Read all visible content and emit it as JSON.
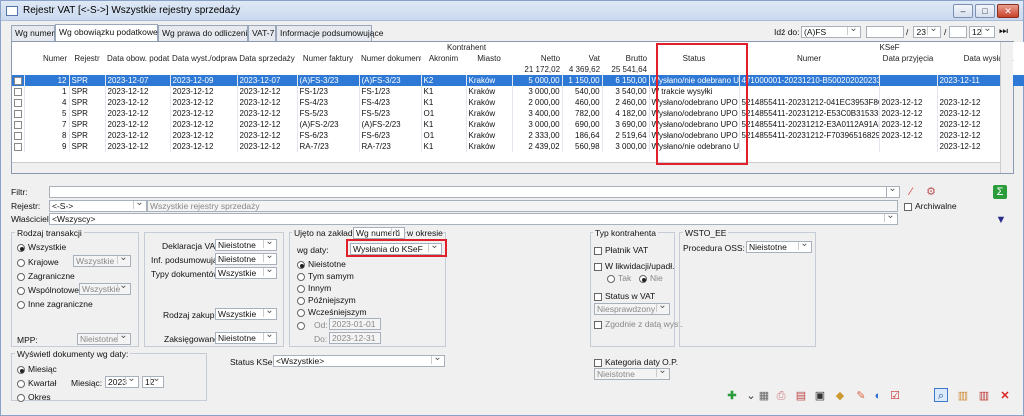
{
  "window": {
    "title": "Rejestr VAT  [<-S->]  Wszystkie rejestry sprzedaży",
    "min": "–",
    "max": "□",
    "close": "✕"
  },
  "tabs": [
    "Wg numeru",
    "Wg obowiązku podatkowego",
    "Wg prawa do odliczenia",
    "VAT-7",
    "Informacje podsumowujące"
  ],
  "nav": {
    "label": "Idź do:",
    "reg": "(A)FS",
    "num": "",
    "month": "23",
    "year": "12"
  },
  "grid": {
    "group_kontrahent": "Kontrahent",
    "group_ksef": "KSeF",
    "cols": [
      "",
      "Numer",
      "Rejestr",
      "Data obow. podat.",
      "Data wyst./odpraw.",
      "Data sprzedaży",
      "Numer faktury",
      "Numer dokumentu",
      "Akronim",
      "Miasto",
      "Netto",
      "Vat",
      "Brutto",
      "Status",
      "Numer",
      "Data przyjęcia",
      "Data wysłania"
    ],
    "totals": {
      "netto": "21 172,02",
      "vat": "4 369,62",
      "brutto": "25 541,64"
    },
    "rows": [
      [
        "",
        "12",
        "SPR",
        "2023-12-07",
        "2023-12-09",
        "2023-12-07",
        "(A)FS-3/23",
        "(A)FS-3/23",
        "K2",
        "Kraków",
        "5 000,00",
        "1 150,00",
        "6 150,00",
        "Wysłano/nie odebrano UPO",
        "471000001-20231210-B500202020233-DD",
        "",
        "2023-12-11"
      ],
      [
        "",
        "1",
        "SPR",
        "2023-12-12",
        "2023-12-12",
        "2023-12-12",
        "FS-1/23",
        "FS-1/23",
        "K1",
        "Kraków",
        "3 000,00",
        "540,00",
        "3 540,00",
        "W trakcie wysyłki",
        "",
        "",
        ""
      ],
      [
        "",
        "4",
        "SPR",
        "2023-12-12",
        "2023-12-12",
        "2023-12-12",
        "FS-4/23",
        "FS-4/23",
        "K1",
        "Kraków",
        "2 000,00",
        "460,00",
        "2 460,00",
        "Wysłano/odebrano UPO",
        "5214855411-20231212-041EC3953F8C-D7",
        "2023-12-12",
        "2023-12-12"
      ],
      [
        "",
        "5",
        "SPR",
        "2023-12-12",
        "2023-12-12",
        "2023-12-12",
        "FS-5/23",
        "FS-5/23",
        "O1",
        "Kraków",
        "3 400,00",
        "782,00",
        "4 182,00",
        "Wysłano/odebrano UPO",
        "5214855411-20231212-E53C0B315335-51",
        "2023-12-12",
        "2023-12-12"
      ],
      [
        "",
        "7",
        "SPR",
        "2023-12-12",
        "2023-12-12",
        "2023-12-12",
        "(A)FS-2/23",
        "(A)FS-2/23",
        "K1",
        "Kraków",
        "3 000,00",
        "690,00",
        "3 690,00",
        "Wysłano/odebrano UPO",
        "5214855411-20231212-E3A0112A91AF-36",
        "2023-12-12",
        "2023-12-12"
      ],
      [
        "",
        "8",
        "SPR",
        "2023-12-12",
        "2023-12-12",
        "2023-12-12",
        "FS-6/23",
        "FS-6/23",
        "O1",
        "Kraków",
        "2 333,00",
        "186,64",
        "2 519,64",
        "Wysłano/odebrano UPO",
        "5214855411-20231212-F70396516829-EA",
        "2023-12-12",
        "2023-12-12"
      ],
      [
        "",
        "9",
        "SPR",
        "2023-12-12",
        "2023-12-12",
        "2023-12-12",
        "RA-7/23",
        "RA-7/23",
        "K1",
        "Kraków",
        "2 439,02",
        "560,98",
        "3 000,00",
        "Wysłano/nie odebrano UPO",
        "",
        "",
        "2023-12-12"
      ]
    ]
  },
  "filter": {
    "filtr_label": "Filtr:",
    "rejestr_label": "Rejestr:",
    "rejestr_value": "<-S->",
    "rejestr_desc": "Wszystkie rejestry sprzedaży",
    "wlasciciel_label": "Właściciel:",
    "wlasciciel_value": "<Wszyscy>",
    "archiwalne": "Archiwalne"
  },
  "rodzaj": {
    "title": "Rodzaj transakcji",
    "options": [
      "Wszystkie",
      "Krajowe",
      "Zagraniczne",
      "Wspólnotowe",
      "Inne zagraniczne"
    ],
    "krajowe_dd": "Wszystkie",
    "wsp_dd": "Wszystkie",
    "mpp_label": "MPP:",
    "mpp_value": "Nieistotne"
  },
  "mid": {
    "dekl_label": "Deklaracja VAT-7:",
    "dekl_value": "Nieistotne",
    "inf_label": "Inf. podsumowujące:",
    "inf_value": "Nieistotne",
    "typy_label": "Typy dokumentów:",
    "typy_value": "Wszystkie",
    "zakup_label": "Rodzaj zakupu:",
    "zakup_value": "Wszystkie",
    "zaks_label": "Zaksięgowano:",
    "zaks_value": "Nieistotne"
  },
  "ujeto": {
    "label": "Ujęto na zakładce",
    "dd": "Wg numeru",
    "okres": "w okresie",
    "wgdaty_label": "wg daty:",
    "wgdaty_value": "Wysłania do KSeF",
    "options": [
      "Nieistotne",
      "Tym samym",
      "Innym",
      "Późniejszym",
      "Wcześniejszym"
    ],
    "od_label": "Od:",
    "od_value": "2023-01-01",
    "do_label": "Do:",
    "do_value": "2023-12-31"
  },
  "typk": {
    "title": "Typ kontrahenta",
    "platnik": "Płatnik VAT",
    "likw": "W likwidacji/upadł.",
    "tak": "Tak",
    "nie": "Nie",
    "status": "Status w VAT",
    "status_dd": "Niesprawdzony",
    "zgodnie": "Zgodnie z datą wyst."
  },
  "wsto": {
    "title": "WSTO_EE",
    "oss_label": "Procedura OSS:",
    "oss_value": "Nieistotne"
  },
  "wysw": {
    "title": "Wyświetl dokumenty wg daty:",
    "options": [
      "Miesiąc",
      "Kwartał",
      "Okres"
    ],
    "mies_label": "Miesiąc:",
    "year": "2023",
    "month": "12"
  },
  "ksef": {
    "label": "Status KSeF:",
    "value": "<Wszystkie>"
  },
  "kat": {
    "label": "Kategoria daty O.P.",
    "value": "Nieistotne"
  },
  "colors": {
    "selection": "#2e78d6",
    "highlight": "#e0202a"
  }
}
